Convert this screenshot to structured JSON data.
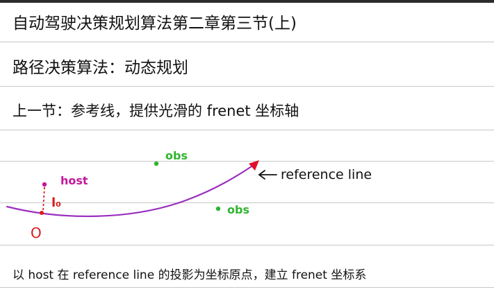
{
  "notes": {
    "title": "自动驾驶决策规划算法第二章第三节(上)",
    "subtitle": "路径决策算法：动态规划",
    "recap": "上一节：参考线，提供光滑的 frenet 坐标轴",
    "conclusion": "以 host 在 reference line 的投影为坐标原点，建立 frenet 坐标系"
  },
  "diagram": {
    "host_label": "host",
    "l0_label": "l₀",
    "origin_label": "O",
    "obs_label_1": "obs",
    "obs_label_2": "obs",
    "reference_line_label": "reference line",
    "colors": {
      "curve": "#9b2fbf",
      "host": "#c2189e",
      "origin": "#d91c1c",
      "obstacle": "#2fb52f",
      "arrowhead": "#e0102a",
      "ink": "#111111"
    }
  }
}
